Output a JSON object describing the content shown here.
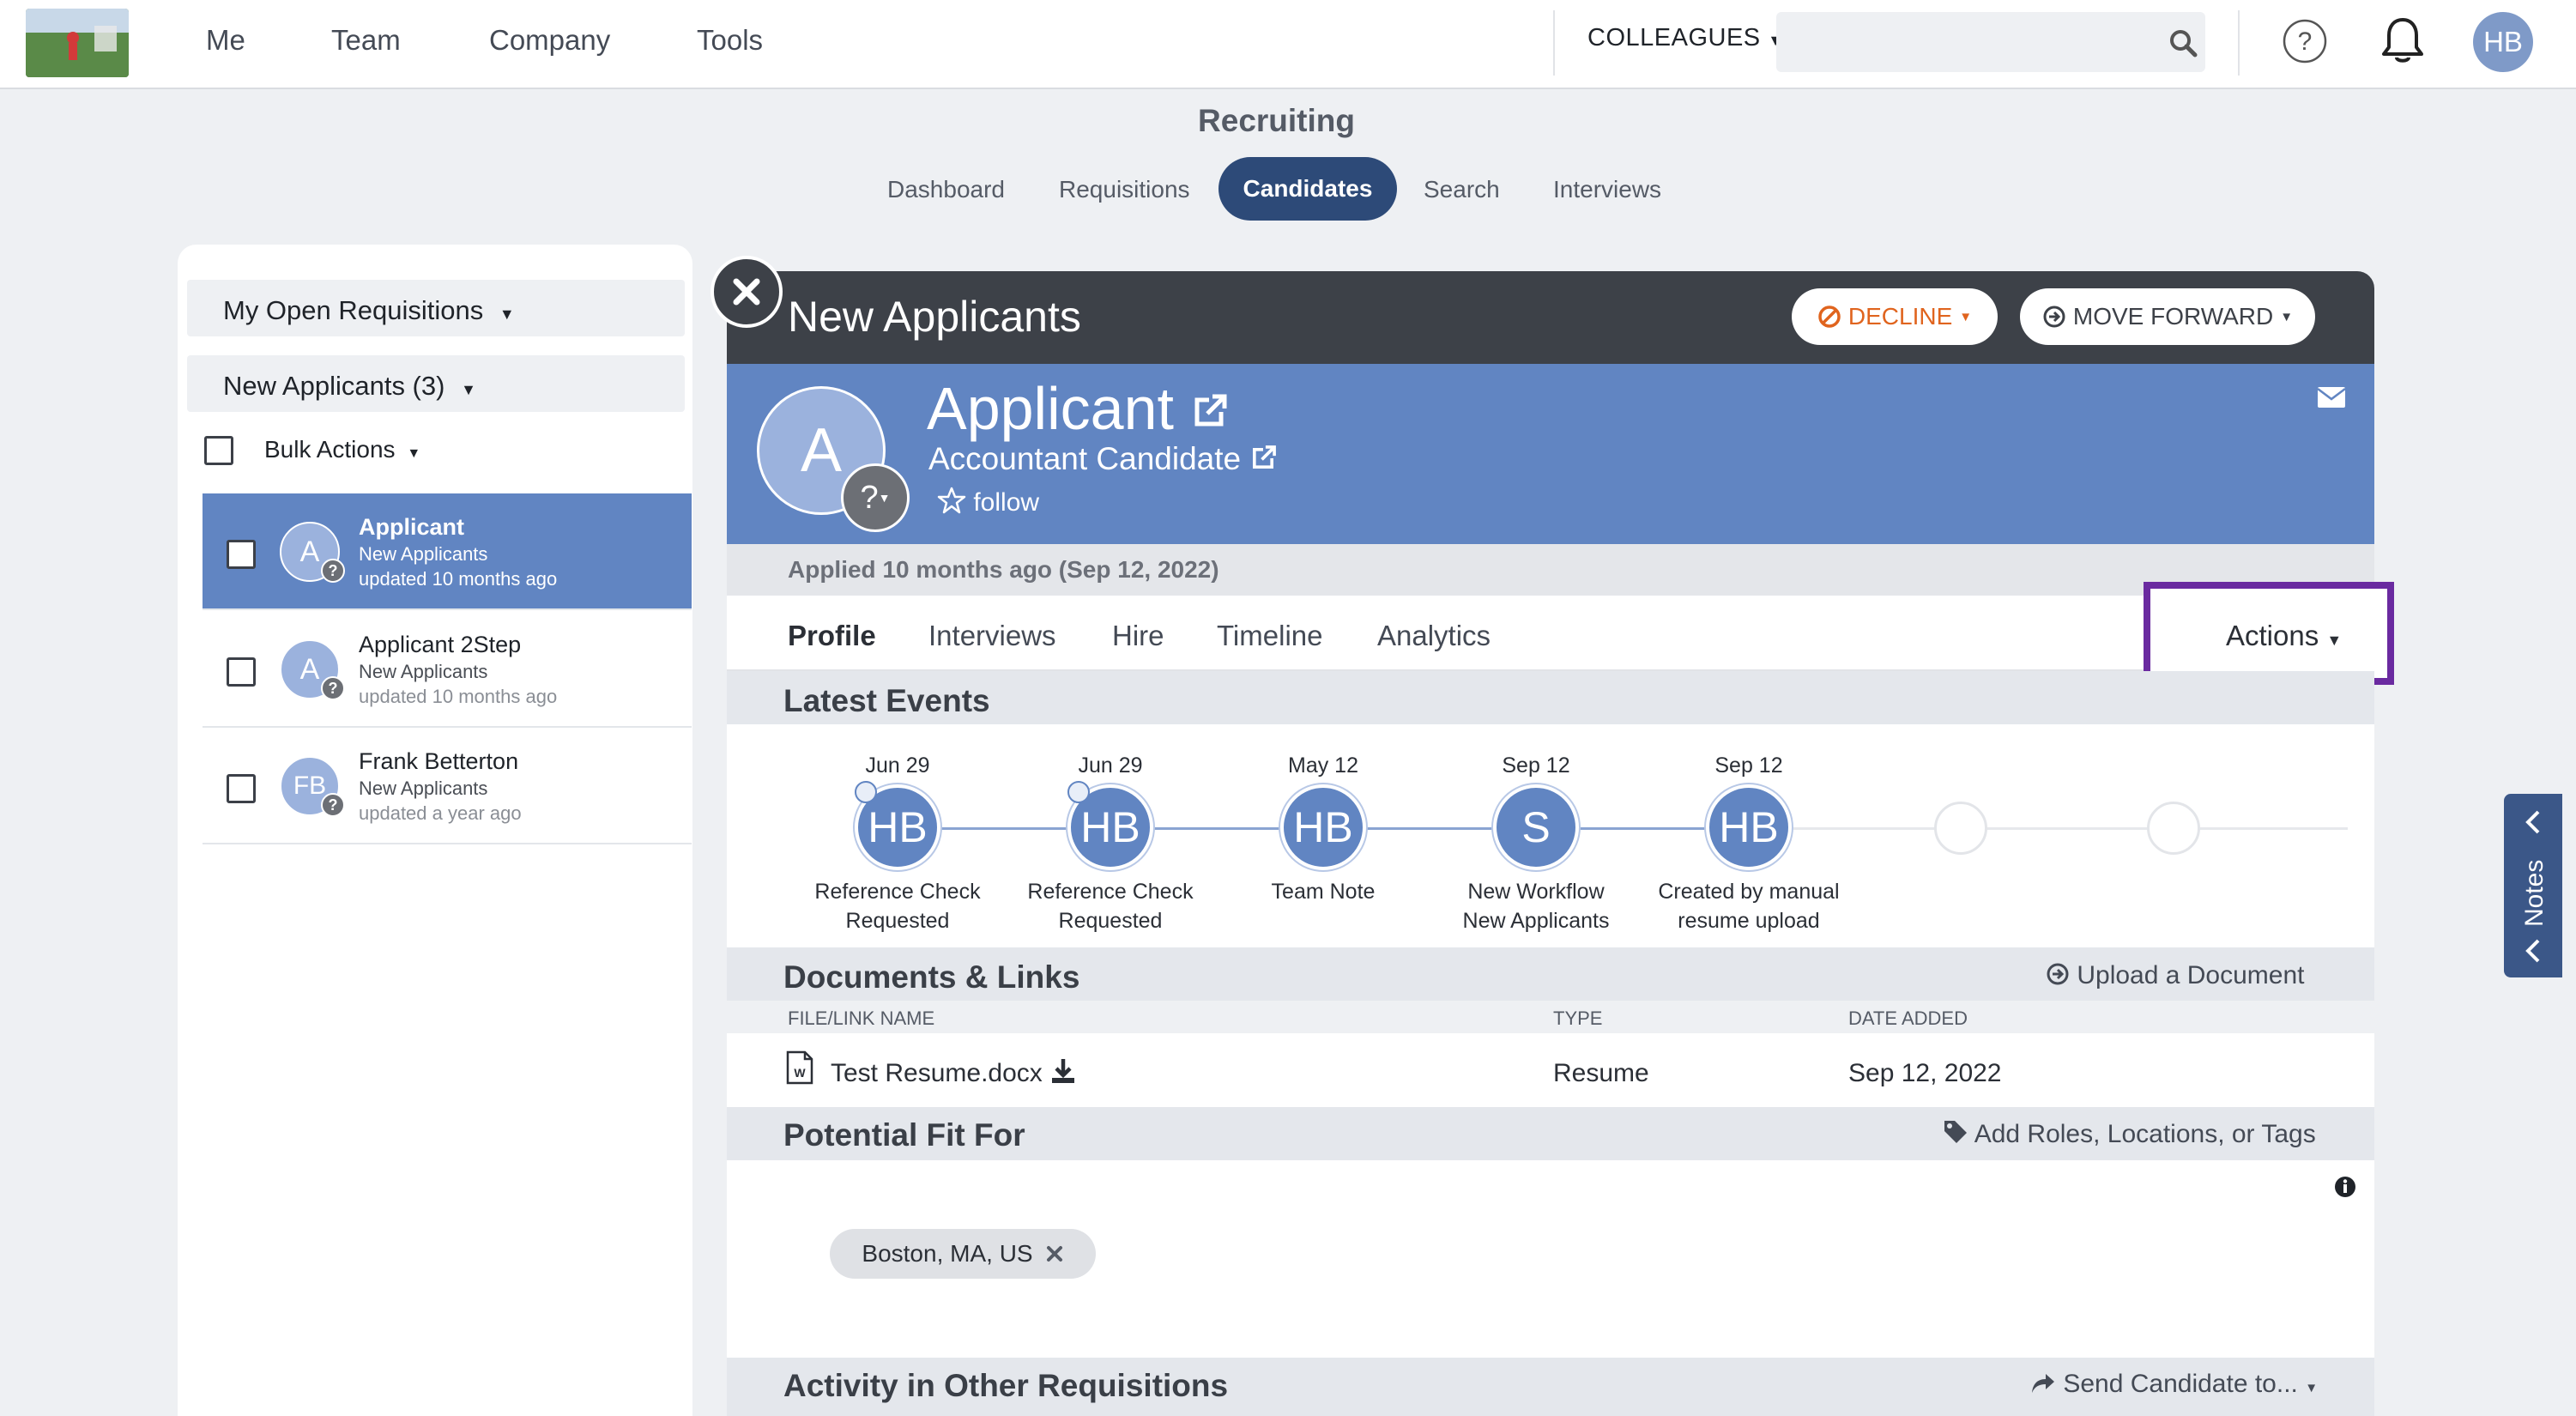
{
  "topnav": {
    "links": [
      "Me",
      "Team",
      "Company",
      "Tools"
    ],
    "colleagues_label": "COLLEAGUES",
    "search_placeholder": "",
    "avatar_initials": "HB"
  },
  "module": {
    "title": "Recruiting",
    "tabs": [
      "Dashboard",
      "Requisitions",
      "Candidates",
      "Search",
      "Interviews"
    ],
    "active_tab": "Candidates"
  },
  "sidebar": {
    "requisition_filter": "My Open Requisitions",
    "stage_filter": "New Applicants (3)",
    "bulk_actions": "Bulk Actions",
    "candidates": [
      {
        "initials": "A",
        "name": "Applicant",
        "stage": "New Applicants",
        "updated": "updated 10 months ago"
      },
      {
        "initials": "A",
        "name": "Applicant 2Step",
        "stage": "New Applicants",
        "updated": "updated 10 months ago"
      },
      {
        "initials": "FB",
        "name": "Frank Betterton",
        "stage": "New Applicants",
        "updated": "updated a year ago"
      }
    ]
  },
  "panel": {
    "stage_title": "New Applicants",
    "decline_label": "DECLINE",
    "move_forward_label": "MOVE FORWARD",
    "candidate_initial": "A",
    "candidate_name": "Applicant",
    "candidate_title": "Accountant Candidate",
    "follow_label": "follow",
    "applied_text": "Applied 10 months ago (Sep 12, 2022)",
    "profile_tabs": [
      "Profile",
      "Interviews",
      "Hire",
      "Timeline",
      "Analytics"
    ],
    "actions_label": "Actions"
  },
  "latest_events": {
    "title": "Latest Events",
    "events": [
      {
        "date": "Jun 29",
        "initials": "HB",
        "label_1": "Reference Check",
        "label_2": "Requested"
      },
      {
        "date": "Jun 29",
        "initials": "HB",
        "label_1": "Reference Check",
        "label_2": "Requested"
      },
      {
        "date": "May 12",
        "initials": "HB",
        "label_1": "Team Note",
        "label_2": ""
      },
      {
        "date": "Sep 12",
        "initials": "S",
        "label_1": "New Workflow",
        "label_2": "New Applicants"
      },
      {
        "date": "Sep 12",
        "initials": "HB",
        "label_1": "Created by manual",
        "label_2": "resume upload"
      }
    ]
  },
  "documents": {
    "title": "Documents & Links",
    "upload_label": "Upload a Document",
    "columns": [
      "FILE/LINK NAME",
      "TYPE",
      "DATE ADDED"
    ],
    "rows": [
      {
        "name": "Test Resume.docx",
        "type": "Resume",
        "date": "Sep 12, 2022"
      }
    ]
  },
  "potential_fit": {
    "title": "Potential Fit For",
    "add_label": "Add Roles, Locations, or Tags",
    "tags": [
      "Boston, MA, US"
    ]
  },
  "other_reqs": {
    "title": "Activity in Other Requisitions",
    "send_label": "Send Candidate to..."
  },
  "notes_tab": {
    "label": "Notes"
  },
  "colors": {
    "accent_blue": "#6185c2",
    "dark_header": "#3d4148",
    "active_tab": "#2d4a78",
    "decline_orange": "#e0641e",
    "highlight_purple": "#6a2aa0"
  }
}
